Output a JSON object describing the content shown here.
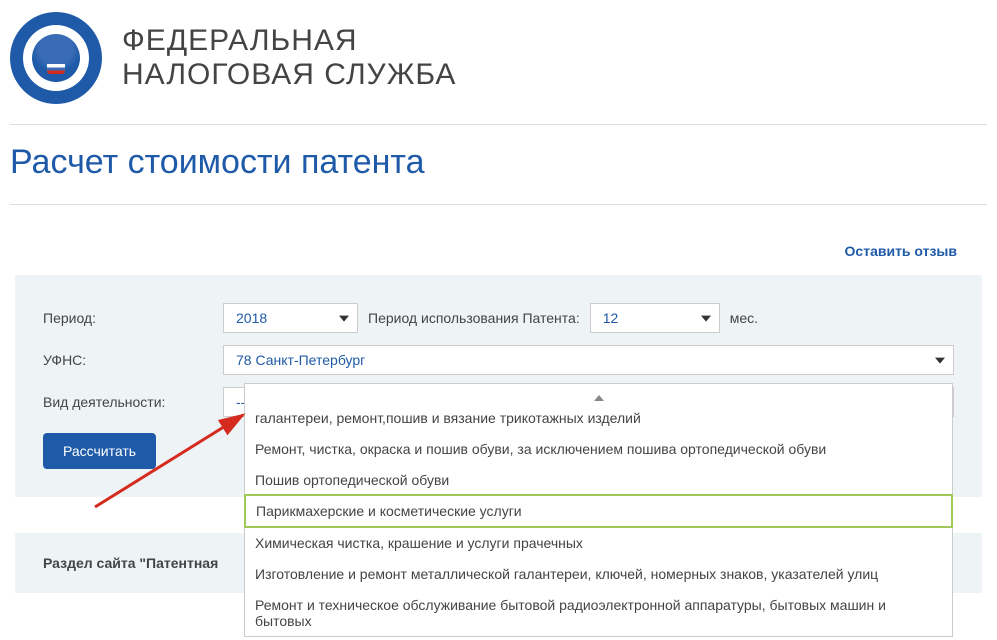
{
  "org": {
    "title_line1": "ФЕДЕРАЛЬНАЯ",
    "title_line2": "НАЛОГОВАЯ СЛУЖБА"
  },
  "page_title": "Расчет стоимости патента",
  "feedback_link": "Оставить отзыв",
  "form": {
    "period_label": "Период:",
    "year_value": "2018",
    "usage_period_label": "Период использования Патента:",
    "months_value": "12",
    "months_suffix": "мес.",
    "ufns_label": "УФНС:",
    "ufns_value": "78 Санкт-Петербург",
    "activity_label": "Вид деятельности:",
    "activity_placeholder": "--Выберите--",
    "calc_button": "Рассчитать"
  },
  "dropdown": {
    "items": [
      "галантереи, ремонт,пошив и вязание трикотажных изделий",
      "Ремонт, чистка, окраска и пошив обуви, за исключением пошива ортопедической обуви",
      "Пошив ортопедической обуви",
      "Парикмахерские и косметические услуги",
      "Химическая чистка, крашение и услуги прачечных",
      "Изготовление и ремонт металлической галантереи, ключей, номерных знаков, указателей улиц",
      "Ремонт и техническое обслуживание бытовой радиоэлектронной аппаратуры, бытовых машин и бытовых"
    ],
    "highlighted_index": 3
  },
  "footer_link": "Раздел сайта \"Патентная"
}
